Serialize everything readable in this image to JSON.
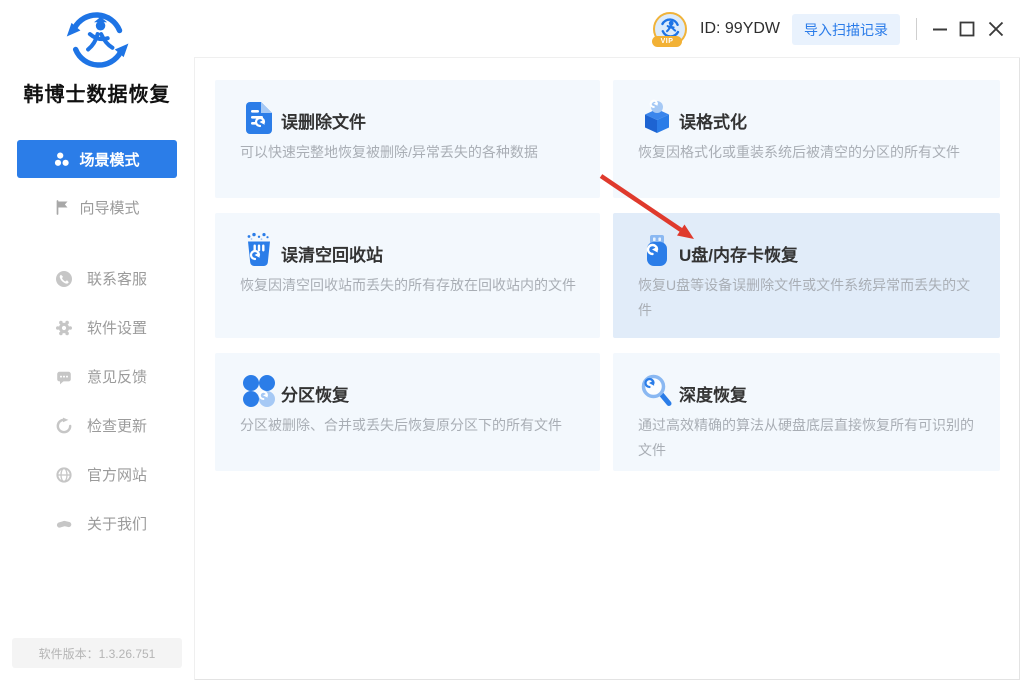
{
  "app": {
    "name": "韩博士数据恢复",
    "version_label": "软件版本：1.3.26.751",
    "logo_icon": "recycle-person-logo"
  },
  "header": {
    "vip_label": "VIP",
    "user_id": "ID: 99YDW",
    "import_button": "导入扫描记录",
    "window_controls": [
      "minimize",
      "maximize",
      "close"
    ]
  },
  "sidebar": {
    "modes": [
      {
        "label": "场景模式",
        "icon": "cluster-circles-icon",
        "active": true
      },
      {
        "label": "向导模式",
        "icon": "flag-icon",
        "active": false
      }
    ],
    "items": [
      {
        "label": "联系客服",
        "icon": "phone-icon"
      },
      {
        "label": "软件设置",
        "icon": "gear-icon"
      },
      {
        "label": "意见反馈",
        "icon": "comment-icon"
      },
      {
        "label": "检查更新",
        "icon": "refresh-icon"
      },
      {
        "label": "官方网站",
        "icon": "globe-icon"
      },
      {
        "label": "关于我们",
        "icon": "handshake-icon"
      }
    ]
  },
  "cards": [
    {
      "title": "误删除文件",
      "description": "可以快速完整地恢复被删除/异常丢失的各种数据",
      "icon": "file-restore-icon",
      "highlighted": false
    },
    {
      "title": "误格式化",
      "description": "恢复因格式化或重装系统后被清空的分区的所有文件",
      "icon": "cube-restore-icon",
      "highlighted": false
    },
    {
      "title": "误清空回收站",
      "description": "恢复因清空回收站而丢失的所有存放在回收站内的文件",
      "icon": "recycle-bin-restore-icon",
      "highlighted": false
    },
    {
      "title": "U盘/内存卡恢复",
      "description": "恢复U盘等设备误删除文件或文件系统异常而丢失的文件",
      "icon": "usb-restore-icon",
      "highlighted": true
    },
    {
      "title": "分区恢复",
      "description": "分区被删除、合并或丢失后恢复原分区下的所有文件",
      "icon": "partition-restore-icon",
      "highlighted": false
    },
    {
      "title": "深度恢复",
      "description": "通过高效精确的算法从硬盘底层直接恢复所有可识别的文件",
      "icon": "magnifier-restore-icon",
      "highlighted": false
    }
  ],
  "colors": {
    "accent_blue": "#2b7de8",
    "light_blue": "#a6c9f5",
    "card_bg": "#f3f8fd",
    "card_bg_highlighted": "#e1ecf9",
    "annotation_arrow_red": "#df3a2d",
    "vip_gold": "#f2b135"
  }
}
